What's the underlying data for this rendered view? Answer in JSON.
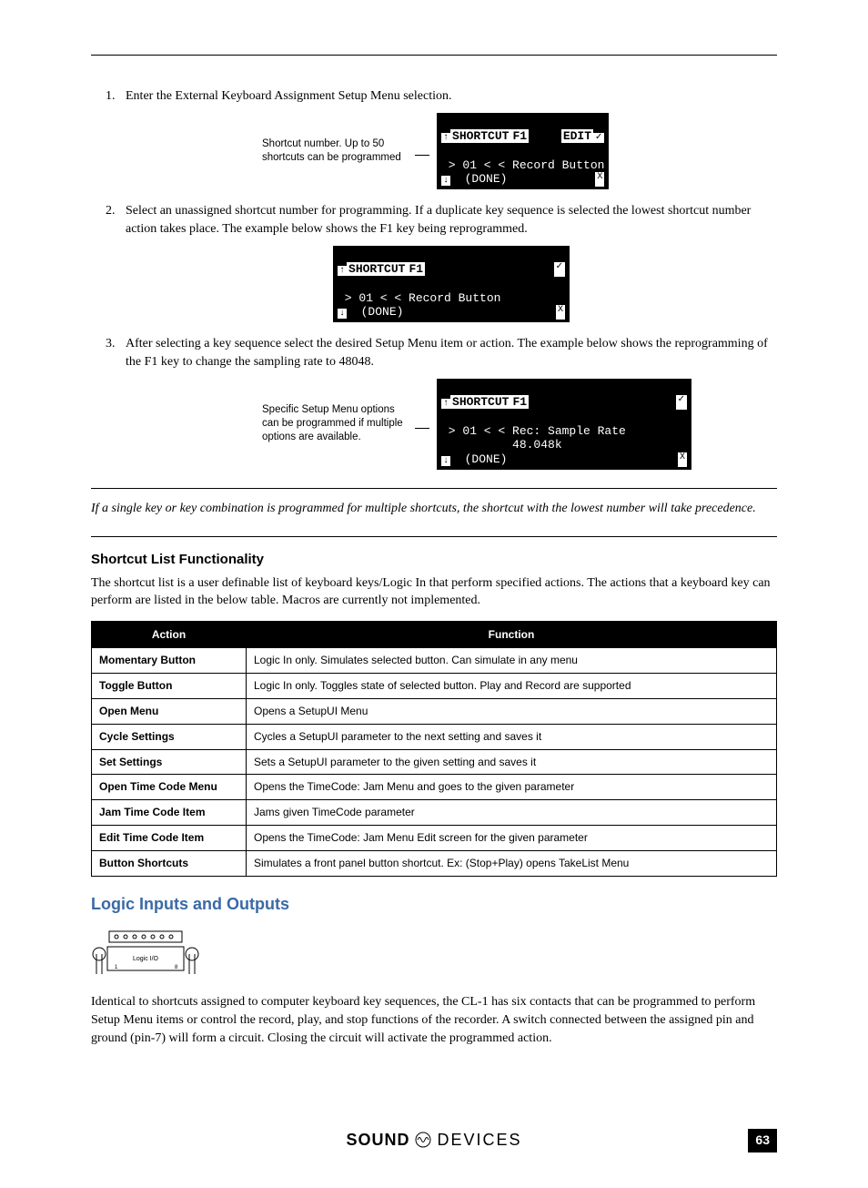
{
  "steps": {
    "s1": "Enter the External Keyboard Assignment Setup Menu selection.",
    "s2": "Select an unassigned shortcut number for programming. If a duplicate key sequence is selected the lowest shortcut number action takes place. The example below shows the F1 key being reprogrammed.",
    "s3": "After selecting a key sequence select the desired Setup Menu item or action. The example below shows the reprogramming of the F1 key to change the sampling rate to 48048."
  },
  "fig1": {
    "caption": "Shortcut number. Up to 50 shortcuts can be programmed",
    "top_left_tag": "SHORTCUT",
    "top_mid_tag": "F1",
    "top_right_tag": "EDIT",
    "line2": " > 01 < < Record Button",
    "bot_mid": "  (DONE)"
  },
  "fig2": {
    "top_left_tag": "SHORTCUT",
    "top_mid_tag": "F1",
    "line2": " > 01 < < Record Button",
    "bot_mid": "  (DONE)"
  },
  "fig3": {
    "caption": "Specific Setup Menu options can be programmed if multiple options are available.",
    "top_left_tag": "SHORTCUT",
    "top_mid_tag": "F1",
    "line2a": " > 01 < < Rec: Sample Rate",
    "line2b": "          48.048k",
    "bot_mid": "  (DONE)"
  },
  "note_text": "If a single key or key combination is programmed for multiple shortcuts, the shortcut with the lowest number will take precedence.",
  "shortcut_heading": "Shortcut List Functionality",
  "shortcut_para": "The shortcut list is a user definable list of keyboard keys/Logic In that perform specified actions. The actions that a keyboard key can perform are listed in the below table.  Macros are currently not implemented.",
  "table": {
    "headers": {
      "c1": "Action",
      "c2": "Function"
    },
    "rows": [
      {
        "a": "Momentary Button",
        "f": "Logic In only. Simulates selected button. Can simulate in any menu"
      },
      {
        "a": "Toggle Button",
        "f": "Logic In only. Toggles state of selected button. Play and Record are supported"
      },
      {
        "a": "Open Menu",
        "f": "Opens a SetupUI Menu"
      },
      {
        "a": "Cycle Settings",
        "f": "Cycles a SetupUI parameter to the next setting and saves it"
      },
      {
        "a": "Set Settings",
        "f": "Sets a SetupUI parameter to the given setting and saves it"
      },
      {
        "a": "Open Time Code Menu",
        "f": "Opens the TimeCode: Jam Menu and goes to the given parameter"
      },
      {
        "a": "Jam Time Code Item",
        "f": "Jams given TimeCode parameter"
      },
      {
        "a": "Edit Time Code Item",
        "f": "Opens the TimeCode: Jam Menu Edit screen for the given parameter"
      },
      {
        "a": "Button Shortcuts",
        "f": "Simulates a front panel button shortcut. Ex: (Stop+Play) opens TakeList Menu"
      }
    ]
  },
  "logic_heading": "Logic Inputs and Outputs",
  "logic_para": "Identical to shortcuts assigned to computer keyboard key sequences, the CL-1 has six contacts that can be programmed to perform Setup Menu items or control the record, play, and stop functions of the recorder. A switch connected between the assigned pin and ground (pin-7) will form a circuit. Closing the circuit will activate the programmed action.",
  "connector_label": "Logic I/O",
  "footer": {
    "brand_bold": "SOUND",
    "brand_light": "DEVICES",
    "page": "63"
  }
}
